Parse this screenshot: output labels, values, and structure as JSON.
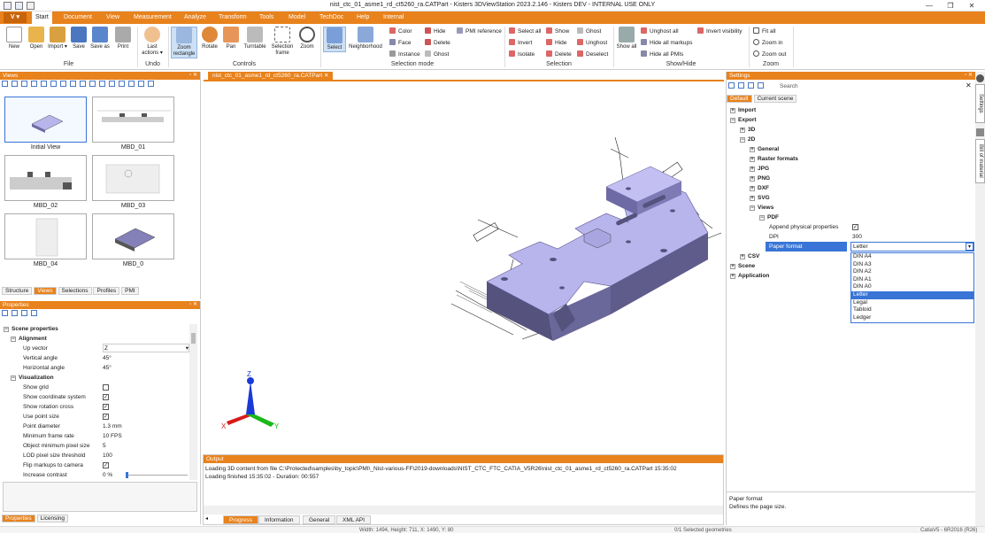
{
  "window": {
    "title": "nist_ctc_01_asme1_rd_ct5260_ra.CATPart - Kisters 3DViewStation 2023.2.146 - Kisters DEV - INTERNAL USE ONLY",
    "app_button": "V"
  },
  "tabs": [
    "Start",
    "Document",
    "View",
    "Measurement",
    "Analyze",
    "Transform",
    "Tools",
    "Model",
    "TechDoc",
    "Help",
    "Internal"
  ],
  "ribbon": {
    "file": {
      "label": "File",
      "buttons": [
        "New",
        "Open",
        "Import",
        "Save",
        "Save as",
        "Print"
      ]
    },
    "undo": {
      "label": "Undo",
      "last_actions": "Last actions"
    },
    "controls": {
      "label": "Controls",
      "buttons": [
        "Zoom rectangle",
        "Rotate",
        "Pan",
        "Turntable",
        "Selection frame",
        "Zoom"
      ]
    },
    "selection_mode": {
      "label": "Selection mode",
      "select": "Select",
      "neighborhood": "Neighborhood",
      "col1": [
        "Color",
        "Face",
        "Instance"
      ],
      "col2": [
        "Hide",
        "Delete",
        "Ghost"
      ],
      "pmi_reference": "PMI reference"
    },
    "selection": {
      "label": "Selection",
      "col1": [
        "Select all",
        "Invert",
        "Isolate"
      ],
      "col2": [
        "Show",
        "Hide",
        "Delete"
      ],
      "col3": [
        "Ghost",
        "Unghost",
        "Deselect"
      ]
    },
    "show_hide": {
      "label": "Show/Hide",
      "show_all": "Show all",
      "col1": [
        "Unghost all",
        "Hide all markups",
        "Hide all PMIs"
      ],
      "invert_visibility": "Invert visibility"
    },
    "zoom": {
      "label": "Zoom",
      "items": [
        "Fit all",
        "Zoom in",
        "Zoom out"
      ]
    }
  },
  "views_panel": {
    "title": "Views",
    "thumbnails": [
      "Initial View",
      "MBD_01",
      "MBD_02",
      "MBD_03",
      "MBD_04",
      "MBD_0"
    ],
    "bottom_tabs": [
      "Structure",
      "Views",
      "Selections",
      "Profiles",
      "PMI"
    ]
  },
  "properties_panel": {
    "title": "Properties",
    "section": "Scene properties",
    "alignment": {
      "label": "Alignment",
      "rows": [
        {
          "name": "Up vector",
          "value": "Z"
        },
        {
          "name": "Vertical angle",
          "value": "45°"
        },
        {
          "name": "Horizontal angle",
          "value": "45°"
        }
      ]
    },
    "visualization": {
      "label": "Visualization",
      "rows": [
        {
          "name": "Show grid",
          "value": ""
        },
        {
          "name": "Show coordinate system",
          "value": "✓"
        },
        {
          "name": "Show rotation cross",
          "value": "✓"
        },
        {
          "name": "Use point size",
          "value": "✓"
        },
        {
          "name": "Point diameter",
          "value": "1.3 mm"
        },
        {
          "name": "Minimum frame rate",
          "value": "10 FPS"
        },
        {
          "name": "Object minimum pixel size",
          "value": "5"
        },
        {
          "name": "LOD pixel size threshold",
          "value": "100"
        },
        {
          "name": "Flip markups to camera",
          "value": "✓"
        },
        {
          "name": "Increase contrast",
          "value": "0 %"
        }
      ]
    },
    "bottom_tabs": [
      "Properties",
      "Licensing"
    ]
  },
  "document_tab": "nist_ctc_01_asme1_rd_ct5260_ra.CATPart",
  "axes": {
    "x": "X",
    "y": "Y",
    "z": "Z"
  },
  "settings_panel": {
    "title": "Settings",
    "search_placeholder": "Search",
    "tabs": [
      "Default",
      "Current scene"
    ],
    "tree": [
      {
        "label": "Import",
        "indent": 0,
        "exp": "+",
        "bold": true
      },
      {
        "label": "Export",
        "indent": 0,
        "exp": "−",
        "bold": true
      },
      {
        "label": "3D",
        "indent": 1,
        "exp": "+",
        "bold": true
      },
      {
        "label": "2D",
        "indent": 1,
        "exp": "−",
        "bold": true
      },
      {
        "label": "General",
        "indent": 2,
        "exp": "+",
        "bold": true
      },
      {
        "label": "Raster formats",
        "indent": 2,
        "exp": "+",
        "bold": true
      },
      {
        "label": "JPG",
        "indent": 2,
        "exp": "+",
        "bold": true
      },
      {
        "label": "PNG",
        "indent": 2,
        "exp": "+",
        "bold": true
      },
      {
        "label": "DXF",
        "indent": 2,
        "exp": "+",
        "bold": true
      },
      {
        "label": "SVG",
        "indent": 2,
        "exp": "+",
        "bold": true
      },
      {
        "label": "Views",
        "indent": 2,
        "exp": "−",
        "bold": true
      },
      {
        "label": "PDF",
        "indent": 3,
        "exp": "−",
        "bold": true
      }
    ],
    "pdf_props": [
      {
        "name": "Append physical properties",
        "value": "✓"
      },
      {
        "name": "DPI",
        "value": "300"
      },
      {
        "name": "Paper format",
        "value": "Letter"
      }
    ],
    "tree_after": [
      {
        "label": "CSV",
        "indent": 1,
        "exp": "+",
        "bold": true
      },
      {
        "label": "Scene",
        "indent": 0,
        "exp": "+",
        "bold": true
      },
      {
        "label": "Application",
        "indent": 0,
        "exp": "+",
        "bold": true
      }
    ],
    "dropdown_options": [
      "DIN A4",
      "DIN A3",
      "DIN A2",
      "DIN A1",
      "DIN A0",
      "Letter",
      "Legal",
      "Tabloid",
      "Ledger"
    ],
    "dropdown_selected": "Letter",
    "description_title": "Paper format",
    "description_text": "Defines the page size.",
    "side_tabs": [
      "Settings",
      "Bill of material"
    ]
  },
  "output_panel": {
    "title": "Output",
    "lines": [
      "Loading 3D content from file C:\\Protected\\samples\\by_topic\\PMI\\_Nist-various-FF\\2019-downloads\\NIST_CTC_FTC_CATIA_V5R26\\nist_ctc_01_asme1_rd_ct5260_ra.CATPart 15:35:02",
      "Loading finished 15:35:02 - Duration: 00:557"
    ],
    "tabs": [
      "Progress",
      "Information",
      "General",
      "XML API"
    ]
  },
  "status_bar": {
    "dimensions": "Width: 1494, Height: 711, X: 1490, Y: 80",
    "selected": "0/1 Selected geometries",
    "format": "CatiaV5 - 6R2016 (R26)"
  },
  "colors": {
    "accent": "#e8821c",
    "part": "#b8b4ec",
    "selection": "#3875d7"
  }
}
